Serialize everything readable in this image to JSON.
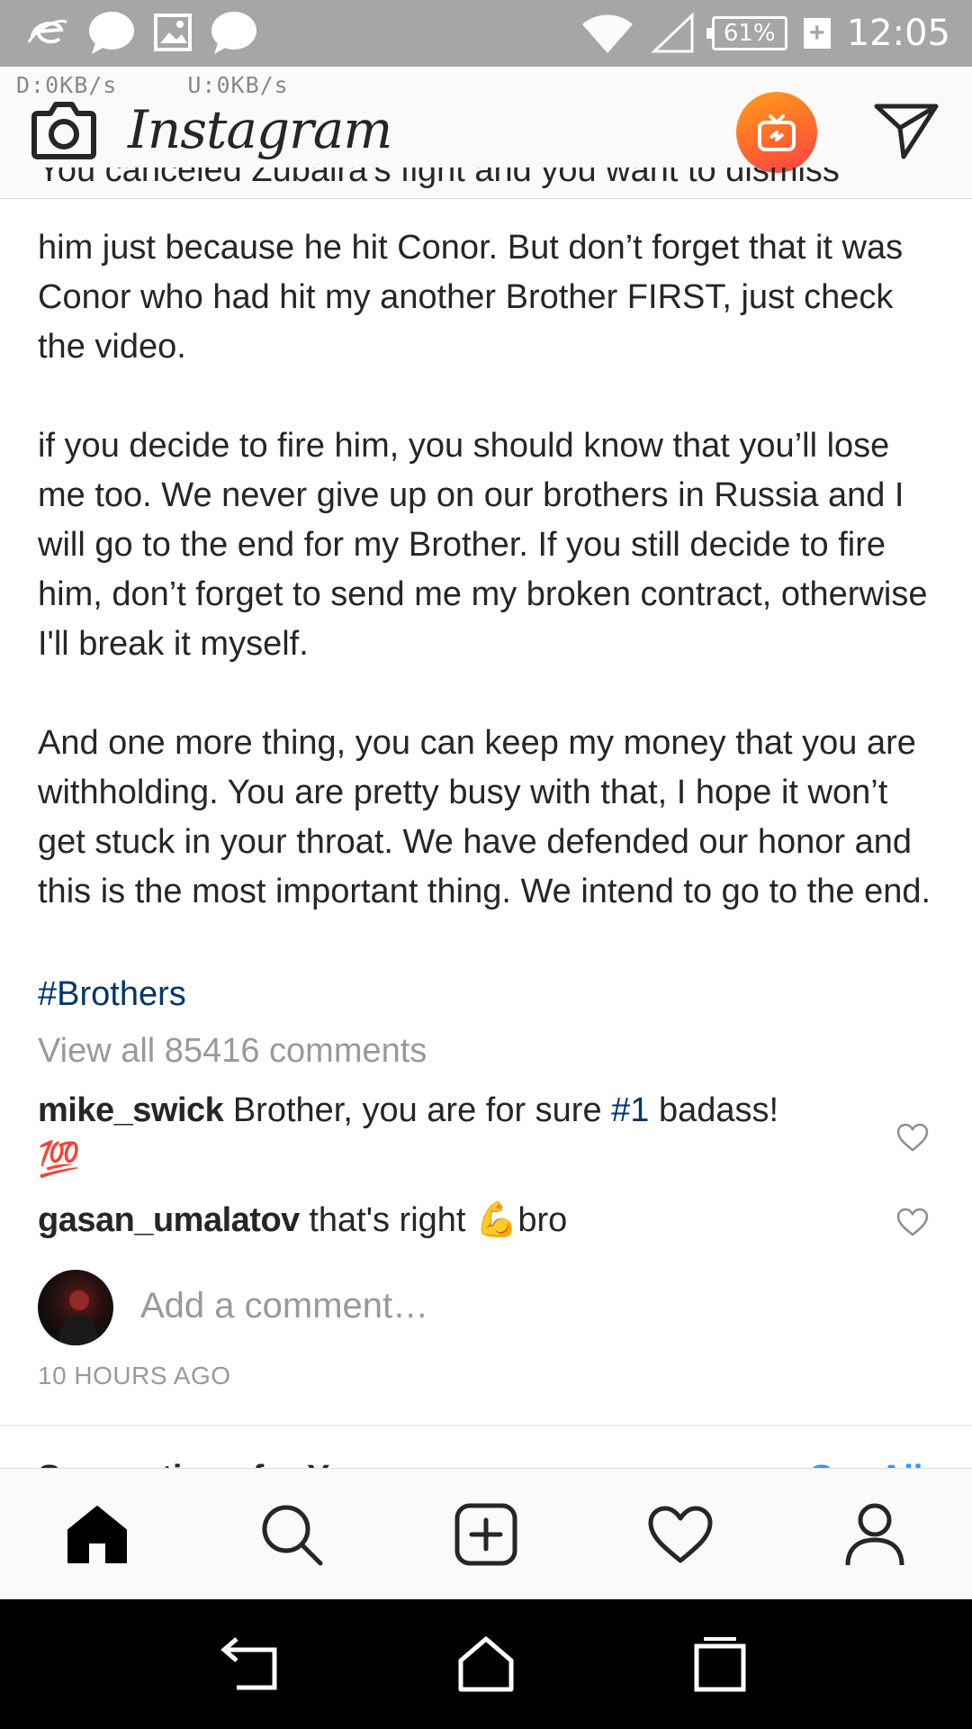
{
  "status_bar": {
    "time": "12:05",
    "battery": "61%",
    "charging_symbol": "+",
    "icons": [
      "ie-icon",
      "chat-bubble-icon",
      "image-icon",
      "chat-bubble-icon",
      "wifi-icon",
      "signal-icon"
    ]
  },
  "net_speed": {
    "down": "D:0KB/s",
    "up": "U:0KB/s"
  },
  "header": {
    "app_name": "Instagram"
  },
  "post": {
    "caption_cut_line": "You canceled Zubaira's fight and you want to dismiss",
    "caption_p1": "him just because he hit Conor. But don’t forget that it was Conor who had hit my another Brother FIRST, just check the video.",
    "caption_p2": "if you decide to fire him, you should know that you’ll lose me too. We never give up on our brothers in Russia and I will go to the end for my Brother. If you still decide to fire him, don’t forget to send me my broken contract, otherwise I'll break it myself.",
    "caption_p3": "And one more thing, you can keep my money that you are withholding. You are pretty busy with that, I hope it won’t get stuck in your throat. We have defended our honor and this is the most important thing. We intend to go to the end.",
    "hashtag": "#Brothers",
    "view_all_comments": "View all 85416 comments",
    "comments": [
      {
        "user": "mike_swick",
        "text_before": " Brother, you are for sure ",
        "tag": "#1",
        "text_after": " badass!",
        "emoji": "💯"
      },
      {
        "user": "gasan_umalatov",
        "text": " that's right ",
        "emoji": "💪",
        "tail": "bro"
      }
    ],
    "add_comment_placeholder": "Add a comment…",
    "timestamp": "10 HOURS AGO"
  },
  "next_section": {
    "title": "Suggestions for You",
    "see_all": "See All"
  },
  "tabs": [
    "home-icon",
    "search-icon",
    "new-post-icon",
    "activity-heart-icon",
    "profile-icon"
  ],
  "colors": {
    "link": "#003569",
    "muted": "#999999",
    "igtv_gradient_start": "#ff9f1a",
    "igtv_gradient_end": "#ff3f4a"
  }
}
